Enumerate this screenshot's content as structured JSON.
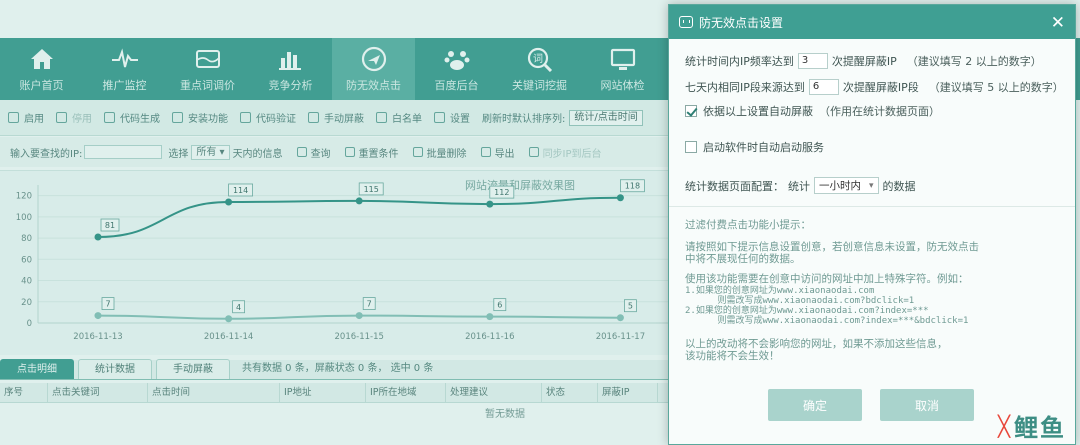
{
  "app": {
    "nav": [
      {
        "label": "账户首页",
        "icon": "home-icon",
        "active": false
      },
      {
        "label": "推广监控",
        "icon": "pulse-icon",
        "active": false
      },
      {
        "label": "重点词调价",
        "icon": "wallet-icon",
        "active": false
      },
      {
        "label": "竞争分析",
        "icon": "bars-icon",
        "active": false
      },
      {
        "label": "防无效点击",
        "icon": "shield-plane-icon",
        "active": true
      },
      {
        "label": "百度后台",
        "icon": "paw-icon",
        "active": false
      },
      {
        "label": "关键词挖掘",
        "icon": "search-word-icon",
        "active": false
      },
      {
        "label": "网站体检",
        "icon": "monitor-icon",
        "active": false
      }
    ],
    "toolbar": [
      {
        "label": "启用",
        "dim": false
      },
      {
        "label": "停用",
        "dim": true
      },
      {
        "label": "代码生成",
        "dim": false
      },
      {
        "label": "安装功能",
        "dim": false
      },
      {
        "label": "代码验证",
        "dim": false
      },
      {
        "label": "手动屏蔽",
        "dim": false
      },
      {
        "label": "白名单",
        "dim": false
      },
      {
        "label": "设置",
        "dim": false
      }
    ],
    "sort_label": "刷新时默认排序列:",
    "sort_value": "统计/点击时间",
    "filter": {
      "ip_label": "输入要查找的IP:",
      "select_label": "选择",
      "select_value": "所有",
      "days_suffix": "天内的信息",
      "query": "查询",
      "reset": "重置条件",
      "batch_delete": "批量删除",
      "export": "导出",
      "sync": "同步IP到后台"
    },
    "tabs": [
      {
        "label": "点击明细",
        "active": true
      },
      {
        "label": "统计数据",
        "active": false
      },
      {
        "label": "手动屏蔽",
        "active": false
      }
    ],
    "summary": "共有数据 0 条，屏蔽状态 0 条， 选中 0 条",
    "columns": [
      "序号",
      "点击关键词",
      "点击时间",
      "IP地址",
      "IP所在地域",
      "处理建议",
      "状态",
      "屏蔽IP"
    ],
    "empty": "暂无数据"
  },
  "chart_data": {
    "type": "line",
    "title": "网站流量和屏蔽效果图",
    "categories": [
      "2016-11-13",
      "2016-11-14",
      "2016-11-15",
      "2016-11-16",
      "2016-11-17"
    ],
    "series": [
      {
        "values": [
          81,
          114,
          115,
          112,
          118
        ],
        "color": "#2f8f84"
      },
      {
        "values": [
          7,
          4,
          7,
          6,
          5
        ],
        "color": "#8bc3bb"
      }
    ],
    "yticks": [
      0,
      20,
      40,
      60,
      80,
      100,
      120
    ],
    "ylim": [
      0,
      130
    ],
    "grid": true
  },
  "dialog": {
    "title": "防无效点击设置",
    "close": "✕",
    "row1": {
      "prefix": "统计时间内IP频率达到",
      "value": "3",
      "suffix": "次提醒屏蔽IP",
      "hint": "（建议填写 2 以上的数字）"
    },
    "row2": {
      "prefix": "七天内相同IP段来源达到",
      "value": "6",
      "suffix": "次提醒屏蔽IP段",
      "hint": "（建议填写 5 以上的数字）"
    },
    "auto_block": {
      "label": "依据以上设置自动屏蔽",
      "note": "（作用在统计数据页面）",
      "checked": true
    },
    "autostart": {
      "label": "启动软件时自动启动服务",
      "checked": false
    },
    "stats_config": {
      "label": "统计数据页面配置：",
      "prefix": "统计",
      "value": "一小时内",
      "suffix": "的数据"
    },
    "tips_title": "过滤付费点击功能小提示：",
    "tip1": "请按照如下提示信息设置创意，若创意信息未设置，防无效点击\n中将不展现任何的数据。",
    "tip2": "使用该功能需要在创意中访问的网址中加上特殊字符。例如：",
    "examples": "1.如果您的创意网址为www.xiaonaodai.com\n      则需改写成www.xiaonaodai.com?bdclick=1\n2.如果您的创意网址为www.xiaonaodai.com?index=***\n      则需改写成www.xiaonaodai.com?index=***&bdclick=1",
    "tip3": "以上的改动将不会影响您的网址，如果不添加这些信息，\n该功能将不会生效！",
    "ok": "确定",
    "cancel": "取消"
  },
  "logo": {
    "mark": "╳",
    "text": "鲤鱼"
  }
}
